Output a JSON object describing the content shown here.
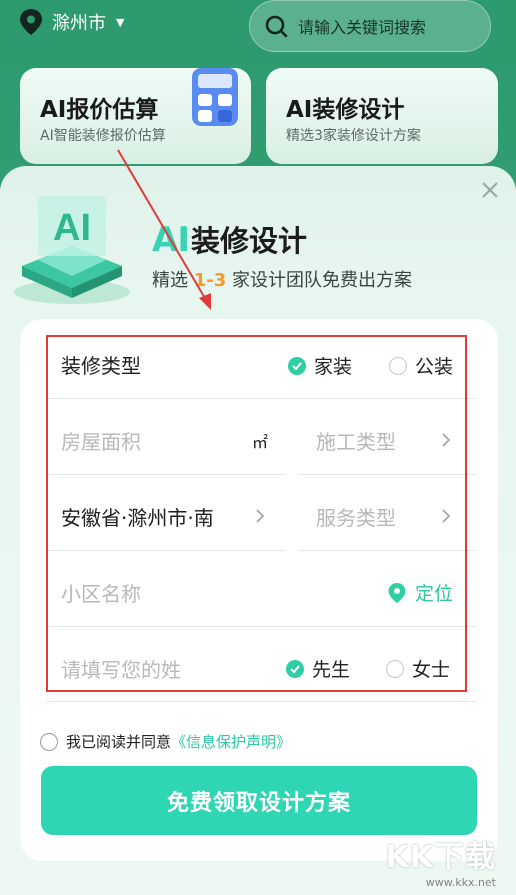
{
  "topbar": {
    "city": "滁州市",
    "search_placeholder": "请输入关键词搜索"
  },
  "cards": [
    {
      "title": "AI报价估算",
      "subtitle": "AI智能装修报价估算"
    },
    {
      "title": "AI装修设计",
      "subtitle": "精选3家装修设计方案"
    }
  ],
  "modal": {
    "title_ai": "AI",
    "title_rest": "装修设计",
    "subtitle_pre": "精选 ",
    "subtitle_hl": "1-3",
    "subtitle_post": " 家设计团队免费出方案",
    "illus_text": "AI"
  },
  "form": {
    "decor_type_label": "装修类型",
    "decor_opt1": "家装",
    "decor_opt2": "公装",
    "area_placeholder": "房屋面积",
    "area_unit": "㎡",
    "construction_placeholder": "施工类型",
    "region_value": "安徽省·滁州市·南",
    "service_placeholder": "服务类型",
    "community_placeholder": "小区名称",
    "locate_label": "定位",
    "surname_placeholder": "请填写您的姓",
    "gender_opt1": "先生",
    "gender_opt2": "女士"
  },
  "agreement": {
    "text": "我已阅读并同意",
    "link": "《信息保护声明》"
  },
  "submit_label": "免费领取设计方案",
  "watermark": {
    "brand": "KK下载",
    "url": "www.kkx.net"
  },
  "colors": {
    "accent": "#2fd6b4",
    "highlight": "#f39a2b",
    "annotation_red": "#e03b3b"
  }
}
